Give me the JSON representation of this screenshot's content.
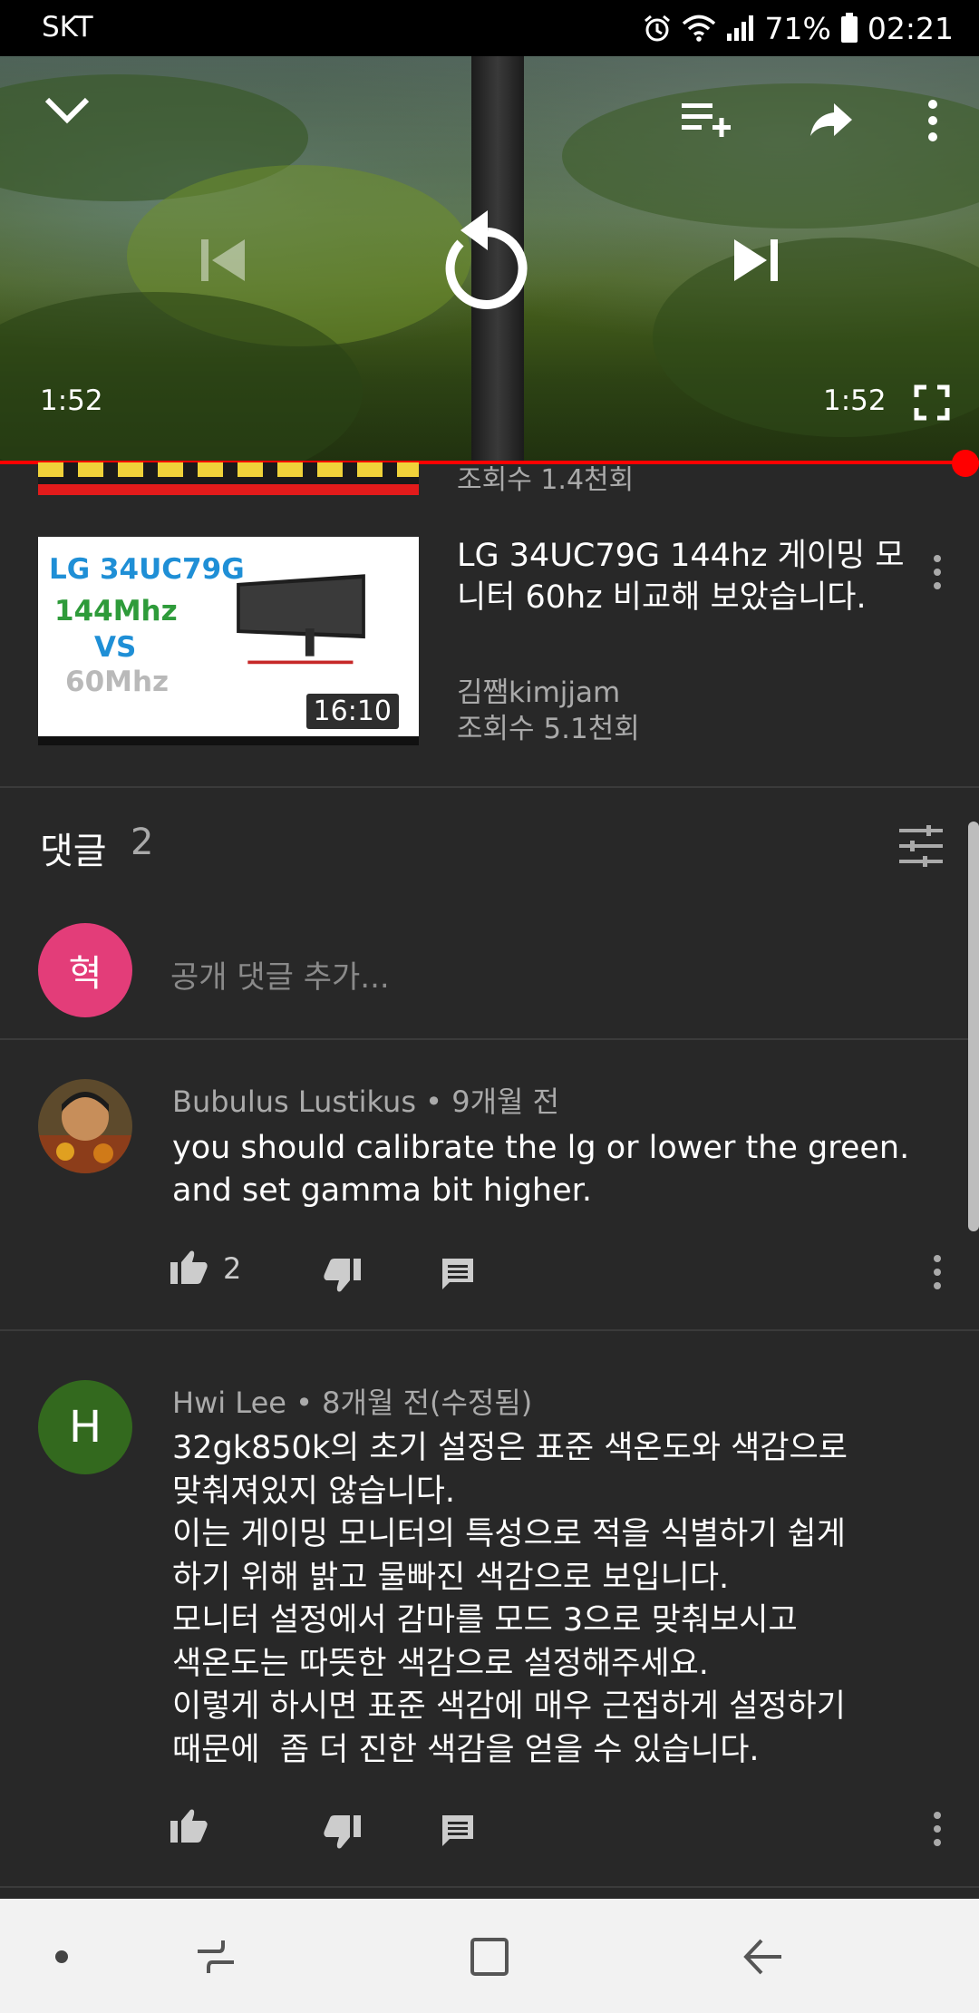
{
  "status_bar": {
    "carrier": "SKT",
    "battery": "71%",
    "time": "02:21",
    "icons": [
      "alarm-icon",
      "wifi-icon",
      "signal-icon",
      "battery-icon"
    ]
  },
  "player": {
    "time_elapsed": "1:52",
    "time_total": "1:52",
    "progress": 1.0,
    "icons": [
      "collapse-chevron-icon",
      "add-to-queue-icon",
      "share-icon",
      "more-vert-icon",
      "previous-icon",
      "replay-icon",
      "next-icon",
      "fullscreen-icon"
    ]
  },
  "previous_item": {
    "views": "조회수 1.4천회"
  },
  "related_video": {
    "title": "LG 34UC79G 144hz 게이밍 모니터 60hz 비교해 보았습니다.",
    "channel": "김쨈kimjjam",
    "views": "조회수 5.1천회",
    "duration": "16:10",
    "thumbnail": {
      "line1": "LG  34UC79G",
      "line2": "144Mhz",
      "line3": "VS",
      "line4": "60Mhz"
    }
  },
  "comments": {
    "title": "댓글",
    "count": "2",
    "my_avatar_letter": "혁",
    "add_placeholder": "공개 댓글 추가...",
    "items": [
      {
        "author": "Bubulus Lustikus",
        "time": "9개월 전",
        "text_lines": [
          "you should calibrate the lg or lower the green.",
          "and set gamma bit higher."
        ],
        "likes": "2"
      },
      {
        "author": "Hwi Lee",
        "time": "8개월 전(수정됨)",
        "avatar_letter": "H",
        "avatar_color": "#33691e",
        "text_lines": [
          "32gk850k의 초기 설정은 표준 색온도와 색감으로",
          "맞춰져있지 않습니다.",
          "이는 게이밍 모니터의 특성으로 적을 식별하기 쉽게",
          "하기 위해 밝고 물빠진 색감으로 보입니다.",
          "모니터 설정에서 감마를 모드 3으로 맞춰보시고",
          "색온도는 따뜻한 색감으로 설정해주세요.",
          "이렇게 하시면 표준 색감에 매우 근접하게 설정하기",
          "때문에  좀 더 진한 색감을 얻을 수 있습니다."
        ],
        "likes": ""
      }
    ]
  },
  "colors": {
    "background": "#282828",
    "accent_red": "#ff0000",
    "secondary_text": "#aaaaaa"
  },
  "nav_bar": {
    "icons": [
      "dot-icon",
      "recents-icon",
      "home-icon",
      "back-icon"
    ]
  }
}
